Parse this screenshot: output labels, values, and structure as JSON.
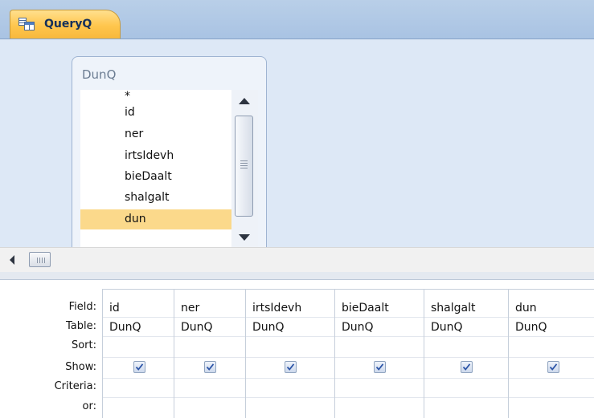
{
  "tab": {
    "title": "QueryQ"
  },
  "table_window": {
    "title": "DunQ",
    "fields": [
      "*",
      "id",
      "ner",
      "irtsIdevh",
      "bieDaalt",
      "shalgalt",
      "dun"
    ],
    "selected_field": "dun"
  },
  "grid": {
    "row_labels": {
      "field": "Field:",
      "table": "Table:",
      "sort": "Sort:",
      "show": "Show:",
      "criteria": "Criteria:",
      "or": "or:"
    },
    "columns": [
      {
        "field": "id",
        "table": "DunQ",
        "show": true
      },
      {
        "field": "ner",
        "table": "DunQ",
        "show": true
      },
      {
        "field": "irtsIdevh",
        "table": "DunQ",
        "show": true
      },
      {
        "field": "bieDaalt",
        "table": "DunQ",
        "show": true
      },
      {
        "field": "shalgalt",
        "table": "DunQ",
        "show": true
      },
      {
        "field": "dun",
        "table": "DunQ",
        "show": true
      }
    ]
  }
}
